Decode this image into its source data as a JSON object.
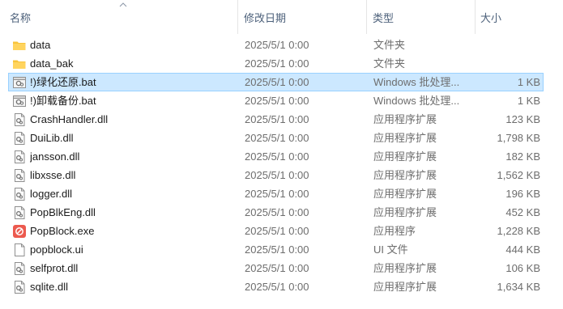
{
  "columns": {
    "name": "名称",
    "date": "修改日期",
    "type": "类型",
    "size": "大小"
  },
  "files": [
    {
      "name": "data",
      "date": "2025/5/1 0:00",
      "type": "文件夹",
      "size": "",
      "icon": "folder-icon",
      "selected": false
    },
    {
      "name": "data_bak",
      "date": "2025/5/1 0:00",
      "type": "文件夹",
      "size": "",
      "icon": "folder-icon",
      "selected": false
    },
    {
      "name": "!)绿化还原.bat",
      "date": "2025/5/1 0:00",
      "type": "Windows 批处理...",
      "size": "1 KB",
      "icon": "batch-file-icon",
      "selected": true
    },
    {
      "name": "!)卸载备份.bat",
      "date": "2025/5/1 0:00",
      "type": "Windows 批处理...",
      "size": "1 KB",
      "icon": "batch-file-icon",
      "selected": false
    },
    {
      "name": "CrashHandler.dll",
      "date": "2025/5/1 0:00",
      "type": "应用程序扩展",
      "size": "123 KB",
      "icon": "dll-file-icon",
      "selected": false
    },
    {
      "name": "DuiLib.dll",
      "date": "2025/5/1 0:00",
      "type": "应用程序扩展",
      "size": "1,798 KB",
      "icon": "dll-file-icon",
      "selected": false
    },
    {
      "name": "jansson.dll",
      "date": "2025/5/1 0:00",
      "type": "应用程序扩展",
      "size": "182 KB",
      "icon": "dll-file-icon",
      "selected": false
    },
    {
      "name": "libxsse.dll",
      "date": "2025/5/1 0:00",
      "type": "应用程序扩展",
      "size": "1,562 KB",
      "icon": "dll-file-icon",
      "selected": false
    },
    {
      "name": "logger.dll",
      "date": "2025/5/1 0:00",
      "type": "应用程序扩展",
      "size": "196 KB",
      "icon": "dll-file-icon",
      "selected": false
    },
    {
      "name": "PopBlkEng.dll",
      "date": "2025/5/1 0:00",
      "type": "应用程序扩展",
      "size": "452 KB",
      "icon": "dll-file-icon",
      "selected": false
    },
    {
      "name": "PopBlock.exe",
      "date": "2025/5/1 0:00",
      "type": "应用程序",
      "size": "1,228 KB",
      "icon": "popblock-app-icon",
      "selected": false
    },
    {
      "name": "popblock.ui",
      "date": "2025/5/1 0:00",
      "type": "UI 文件",
      "size": "444 KB",
      "icon": "blank-file-icon",
      "selected": false
    },
    {
      "name": "selfprot.dll",
      "date": "2025/5/1 0:00",
      "type": "应用程序扩展",
      "size": "106 KB",
      "icon": "dll-file-icon",
      "selected": false
    },
    {
      "name": "sqlite.dll",
      "date": "2025/5/1 0:00",
      "type": "应用程序扩展",
      "size": "1,634 KB",
      "icon": "dll-file-icon",
      "selected": false
    }
  ],
  "colors": {
    "selection_bg": "#cce8ff",
    "selection_border": "#99d1ff",
    "folder": "#f8c43b",
    "app_icon": "#ec5a4f",
    "header_text": "#4c607a"
  }
}
